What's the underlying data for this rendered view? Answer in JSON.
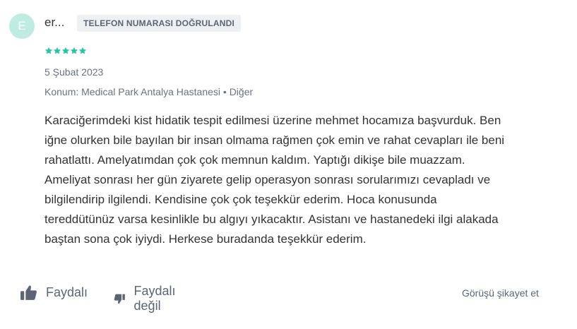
{
  "author": {
    "initial": "E",
    "name": "er..."
  },
  "badge": {
    "label": "TELEFON NUMARASI DOĞRULANDI"
  },
  "rating": {
    "stars": 5,
    "max": 5,
    "color": "#23c6a4"
  },
  "date": "5 Şubat 2023",
  "location": "Konum: Medical Park Antalya Hastanesi • Diğer",
  "comment_lines": [
    "Karaciğerimdeki kist hidatik tespit edilmesi üzerine mehmet hocamıza başvurduk. Ben",
    "iğne olurken bile bayılan bir insan olmama rağmen çok emin ve rahat cevapları ile beni",
    "rahatlattı. Amelyatımdan çok çok memnun kaldım. Yaptığı dikişe bile muazzam.",
    "Ameliyat sonrası her gün ziyarete gelip operasyon sonrası sorularımızı cevapladı ve",
    "bilgilendirip ilgilendi. Kendisine çok çok teşekkür ederim. Hoca konusunda",
    "tereddütünüz varsa kesinlikle bu algıyı yıkacaktır. Asistanı ve hastanedeki ilgi alakada",
    "baştan sona çok iyiydi. Herkese buradanda teşekkür ederim."
  ],
  "actions": {
    "helpful_label": "Faydalı",
    "not_helpful_label": "Faydalı değil",
    "report_label": "Görüşü şikayet et"
  },
  "colors": {
    "avatar_bg": "#bfece0",
    "text_muted": "#6b7280",
    "action": "#5b6575"
  },
  "icons": {
    "helpful": "thumbs-up-icon",
    "not_helpful": "thumbs-down-icon",
    "star": "star-icon"
  }
}
